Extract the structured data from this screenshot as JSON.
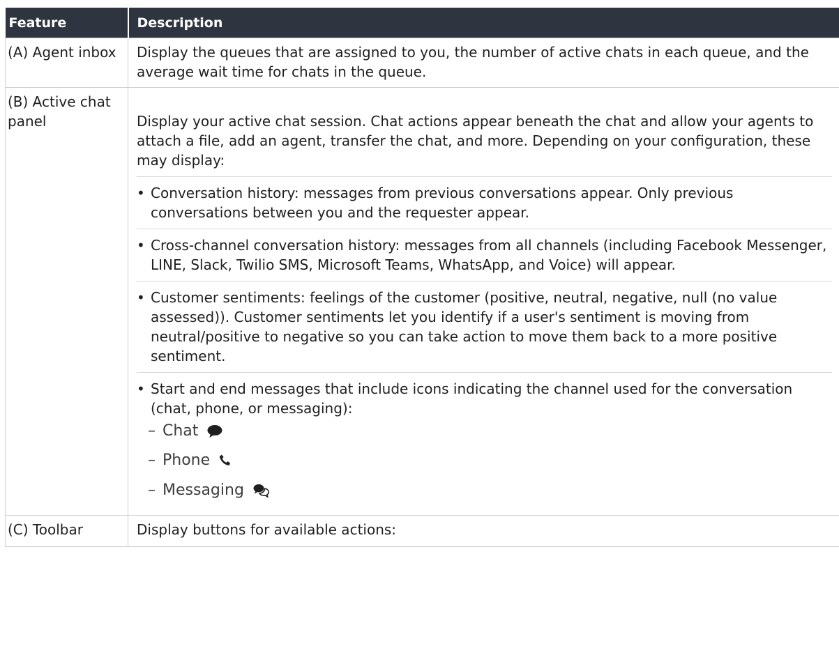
{
  "table": {
    "headers": {
      "feature": "Feature",
      "description": "Description"
    },
    "row_a": {
      "feature": "(A) Agent inbox",
      "description": "Display the queues that are assigned to you, the number of active chats in each queue, and the average wait time for chats in the queue."
    },
    "row_b": {
      "feature": "(B) Active chat panel",
      "intro": "Display your active chat session. Chat actions appear beneath the chat and allow your agents to attach a file, add an agent, transfer the chat, and more. Depending on your configuration, these may display:",
      "bullets": [
        "Conversation history: messages from previous conversations appear. Only previous conversations between you and the requester appear.",
        "Cross-channel conversation history: messages from all channels (including Facebook Messenger, LINE, Slack, Twilio SMS, Microsoft Teams, WhatsApp, and Voice) will appear.",
        "Customer sentiments: feelings of the customer (positive, neutral, negative, null (no value assessed)). Customer sentiments let you identify if a user's sentiment is moving from neutral/positive to negative so you can take action to move them back to a more positive sentiment.",
        "Start and end messages that include icons indicating the channel used for the conversation (chat, phone, or messaging):"
      ],
      "channels": [
        {
          "label": "Chat",
          "icon": "chat-bubble-icon"
        },
        {
          "label": "Phone",
          "icon": "phone-icon"
        },
        {
          "label": "Messaging",
          "icon": "messaging-bubbles-icon"
        }
      ]
    },
    "row_c": {
      "feature": "(C) Toolbar",
      "description": "Display buttons for available actions:"
    }
  },
  "bullet_char": "•",
  "dash_char": "–"
}
